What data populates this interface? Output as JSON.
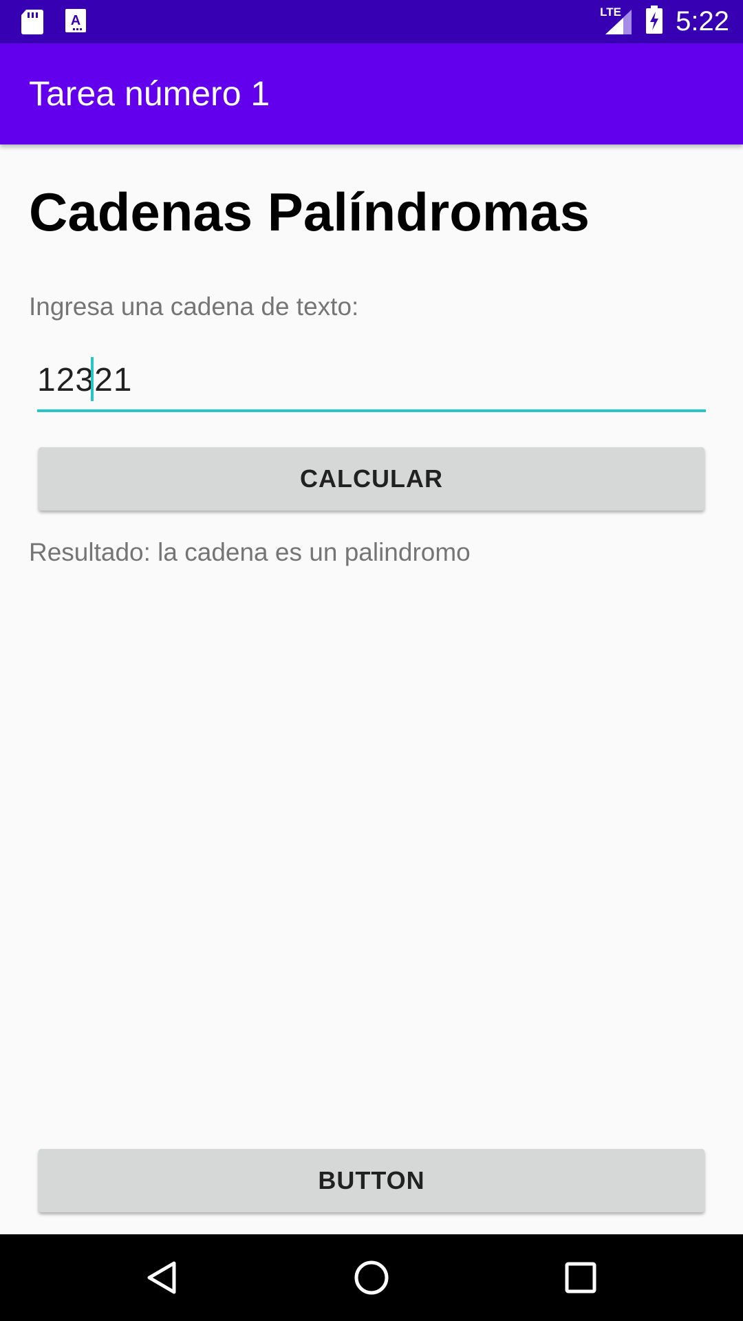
{
  "status_bar": {
    "time": "5:22",
    "network_label": "LTE",
    "icons": [
      "sd-card-icon",
      "text-recognition-icon",
      "lte-signal-icon",
      "battery-charging-icon"
    ],
    "background_color": "#3700b3"
  },
  "app_bar": {
    "title": "Tarea número 1",
    "background_color": "#6200ee"
  },
  "main": {
    "heading": "Cadenas Palíndromas",
    "input_label": "Ingresa una cadena de texto:",
    "input_value": "12321",
    "accent_color": "#26c6c6",
    "calculate_button_label": "CALCULAR",
    "result": "Resultado: la cadena es un palindromo",
    "bottom_button_label": "BUTTON"
  },
  "nav_bar": {
    "icons": [
      "back-icon",
      "home-icon",
      "recents-icon"
    ]
  }
}
